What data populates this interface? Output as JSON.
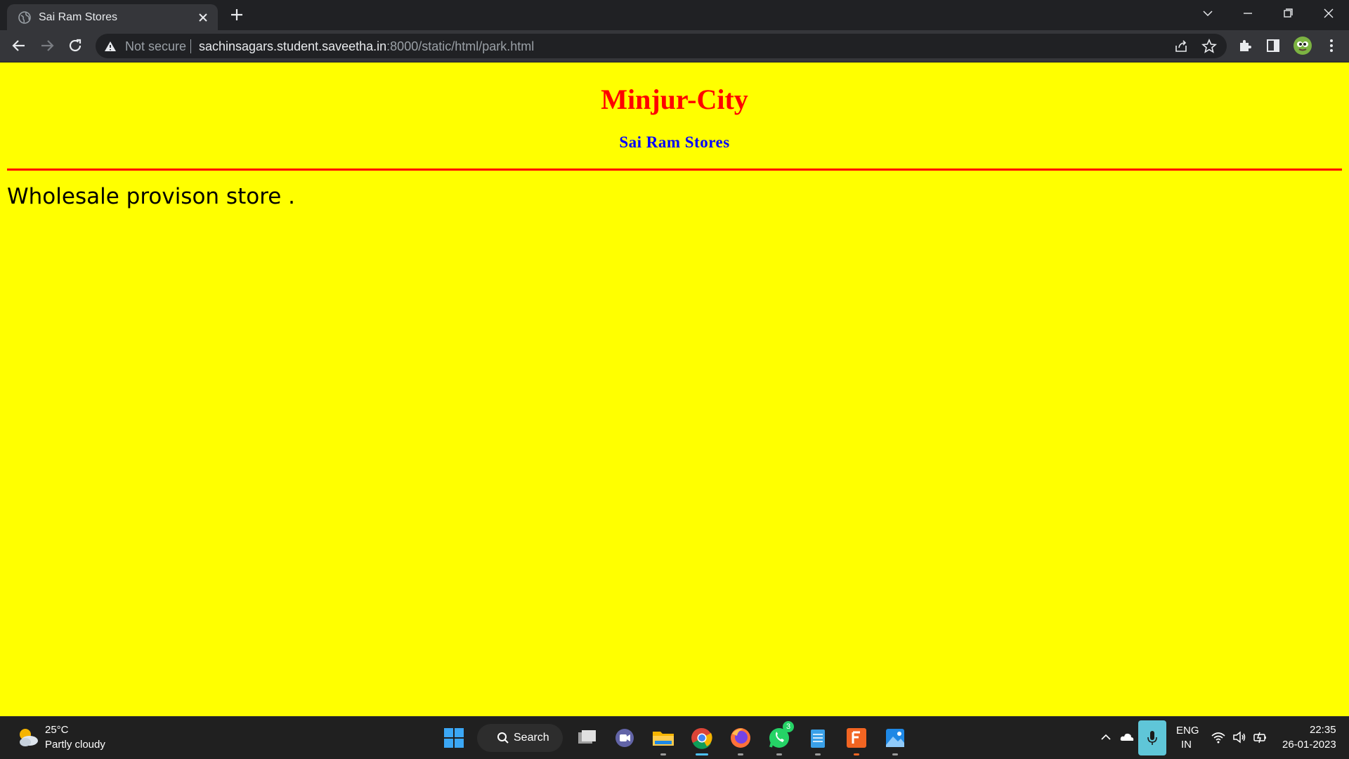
{
  "browser": {
    "tab_title": "Sai Ram Stores",
    "security_label": "Not secure",
    "url_host": "sachinsagars.student.saveetha.in",
    "url_path": ":8000/static/html/park.html"
  },
  "page": {
    "heading": "Minjur-City",
    "subheading": "Sai Ram Stores",
    "body_text": "Wholesale provison store .",
    "colors": {
      "background": "#ffff00",
      "heading": "#ff0000",
      "subheading": "#0000ff",
      "rule": "#ff0000"
    }
  },
  "taskbar": {
    "weather_temp": "25°C",
    "weather_desc": "Partly cloudy",
    "search_label": "Search",
    "whatsapp_badge": "3",
    "lang_line1": "ENG",
    "lang_line2": "IN",
    "time": "22:35",
    "date": "26-01-2023"
  }
}
